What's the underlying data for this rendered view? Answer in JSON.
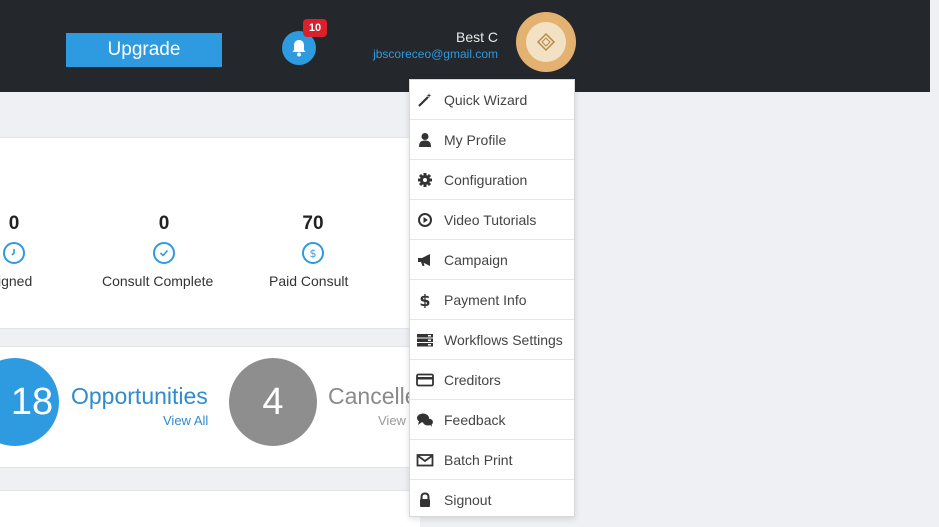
{
  "header": {
    "upgrade_label": "Upgrade",
    "notification_count": "10",
    "user_name": "Best C",
    "user_email": "jbscoreceo@gmail.com"
  },
  "stats": [
    {
      "value": "0",
      "label": "igned",
      "icon": "clock-icon"
    },
    {
      "value": "0",
      "label": "Consult Complete",
      "icon": "check-icon"
    },
    {
      "value": "70",
      "label": "Paid Consult",
      "icon": "dollar-icon"
    }
  ],
  "summary": {
    "opportunities_count": "18",
    "opportunities_label": "Opportunities",
    "opportunities_view": "View All",
    "cancelled_count": "4",
    "cancelled_label": "Cancelle",
    "cancelled_view": "View"
  },
  "menu": {
    "items": [
      {
        "label": "Quick Wizard",
        "icon": "magic-wand-icon"
      },
      {
        "label": "My Profile",
        "icon": "user-icon"
      },
      {
        "label": "Configuration",
        "icon": "gear-icon"
      },
      {
        "label": "Video Tutorials",
        "icon": "play-circle-icon"
      },
      {
        "label": "Campaign",
        "icon": "megaphone-icon"
      },
      {
        "label": "Payment Info",
        "icon": "dollar-icon"
      },
      {
        "label": "Workflows Settings",
        "icon": "server-icon"
      },
      {
        "label": "Creditors",
        "icon": "credit-card-icon"
      },
      {
        "label": "Feedback",
        "icon": "comments-icon"
      },
      {
        "label": "Batch Print",
        "icon": "envelope-icon"
      },
      {
        "label": "Signout",
        "icon": "lock-icon"
      }
    ]
  },
  "colors": {
    "topbar": "#24272c",
    "accent": "#2e9be0",
    "badge": "#d9202b",
    "avatar": "#e3b271"
  }
}
